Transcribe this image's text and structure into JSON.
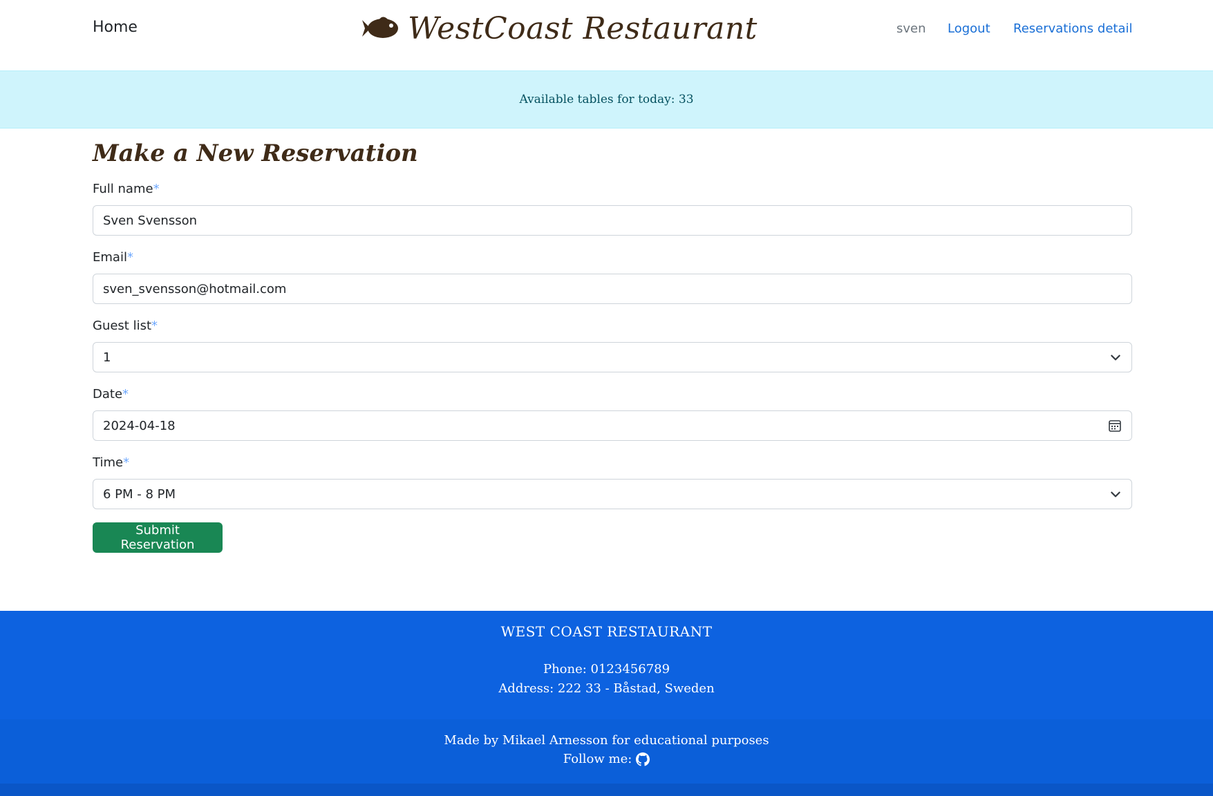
{
  "nav": {
    "home": "Home",
    "brand": "WestCoast Restaurant",
    "brand_icon": "fish-icon",
    "user": "sven",
    "logout": "Logout",
    "reservations": "Reservations detail"
  },
  "alert": {
    "text": "Available tables for today: 33"
  },
  "form": {
    "title": "Make a New Reservation",
    "required_mark": "*",
    "full_name": {
      "label": "Full name",
      "value": "Sven Svensson"
    },
    "email": {
      "label": "Email",
      "value": "sven_svensson@hotmail.com"
    },
    "guests": {
      "label": "Guest list",
      "value": "1"
    },
    "date": {
      "label": "Date",
      "value": "2024-04-18",
      "icon": "calendar-icon"
    },
    "time": {
      "label": "Time",
      "value": "6 PM - 8 PM"
    },
    "submit": "Submit Reservation"
  },
  "footer": {
    "name": "WEST COAST RESTAURANT",
    "phone": "Phone: 0123456789",
    "address": "Address: 222 33 - Båstad, Sweden",
    "made_by": "Made by Mikael Arnesson for educational purposes",
    "follow": "Follow me:",
    "follow_icon": "github-icon"
  },
  "colors": {
    "link": "#1a6fd6",
    "alert_bg": "#cff4fc",
    "submit": "#198754",
    "footer": "#0d62e0",
    "brand": "#3f2b18"
  }
}
